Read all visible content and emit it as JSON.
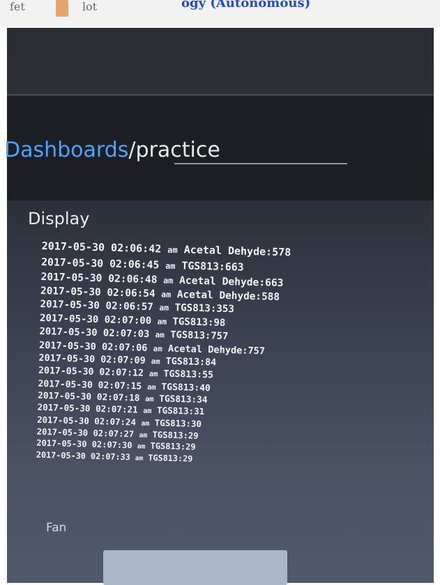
{
  "top_bar": {
    "item1": "fet",
    "item2": "lot",
    "banner_text": "ogy (Autonomous)"
  },
  "breadcrumb": {
    "link": "Dashboards",
    "separator": "/",
    "current": "practice"
  },
  "panel": {
    "title": "Display",
    "log": [
      {
        "date": "2017-05-30",
        "time": "02:06:42",
        "ampm": "am",
        "reading": "Acetal Dehyde:578"
      },
      {
        "date": "2017-05-30",
        "time": "02:06:45",
        "ampm": "am",
        "reading": "TGS813:663"
      },
      {
        "date": "2017-05-30",
        "time": "02:06:48",
        "ampm": "am",
        "reading": "Acetal Dehyde:663"
      },
      {
        "date": "2017-05-30",
        "time": "02:06:54",
        "ampm": "am",
        "reading": "Acetal Dehyde:588"
      },
      {
        "date": "2017-05-30",
        "time": "02:06:57",
        "ampm": "am",
        "reading": "TGS813:353"
      },
      {
        "date": "2017-05-30",
        "time": "02:07:00",
        "ampm": "am",
        "reading": "TGS813:98"
      },
      {
        "date": "2017-05-30",
        "time": "02:07:03",
        "ampm": "am",
        "reading": "TGS813:757"
      },
      {
        "date": "2017-05-30",
        "time": "02:07:06",
        "ampm": "am",
        "reading": "Acetal Dehyde:757"
      },
      {
        "date": "2017-05-30",
        "time": "02:07:09",
        "ampm": "am",
        "reading": "TGS813:84"
      },
      {
        "date": "2017-05-30",
        "time": "02:07:12",
        "ampm": "am",
        "reading": "TGS813:55"
      },
      {
        "date": "2017-05-30",
        "time": "02:07:15",
        "ampm": "am",
        "reading": "TGS813:40"
      },
      {
        "date": "2017-05-30",
        "time": "02:07:18",
        "ampm": "am",
        "reading": "TGS813:34"
      },
      {
        "date": "2017-05-30",
        "time": "02:07:21",
        "ampm": "am",
        "reading": "TGS813:31"
      },
      {
        "date": "2017-05-30",
        "time": "02:07:24",
        "ampm": "am",
        "reading": "TGS813:30"
      },
      {
        "date": "2017-05-30",
        "time": "02:07:27",
        "ampm": "am",
        "reading": "TGS813:29"
      },
      {
        "date": "2017-05-30",
        "time": "02:07:30",
        "ampm": "am",
        "reading": "TGS813:29"
      },
      {
        "date": "2017-05-30",
        "time": "02:07:33",
        "ampm": "am",
        "reading": "TGS813:29"
      }
    ]
  },
  "fan": {
    "label": "Fan"
  }
}
